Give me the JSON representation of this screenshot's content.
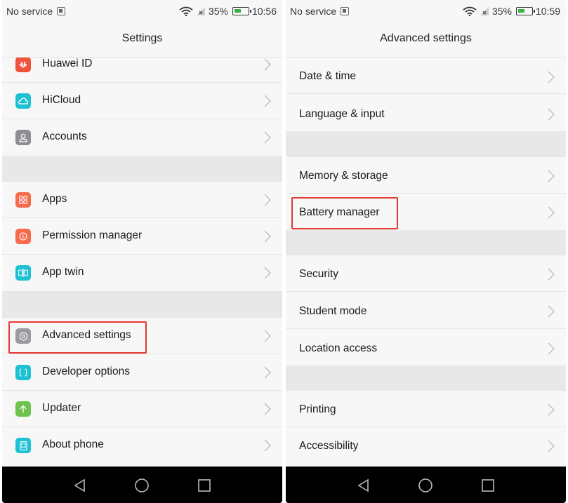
{
  "colors": {
    "highlight": "#e53935",
    "huawei_id": "#f0533b",
    "hicloud": "#1ec1d3",
    "accounts": "#8e8e93",
    "apps": "#f76b4c",
    "permission": "#f76b4c",
    "app_twin": "#1ec1d3",
    "advanced": "#9a9aa0",
    "developer": "#1ec1d3",
    "updater": "#6cc24a",
    "about": "#1ec1d3"
  },
  "left_screen": {
    "status": {
      "carrier": "No service",
      "battery": "35%",
      "time": "10:56"
    },
    "title": "Settings",
    "items": [
      {
        "label": "Huawei ID",
        "icon": "huawei-logo-icon"
      },
      {
        "label": "HiCloud",
        "icon": "cloud-icon"
      },
      {
        "label": "Accounts",
        "icon": "person-icon"
      },
      {
        "label": "Apps",
        "icon": "grid-icon"
      },
      {
        "label": "Permission manager",
        "icon": "shield-icon"
      },
      {
        "label": "App twin",
        "icon": "twin-icon"
      },
      {
        "label": "Advanced settings",
        "icon": "gear-icon"
      },
      {
        "label": "Developer options",
        "icon": "braces-icon"
      },
      {
        "label": "Updater",
        "icon": "arrow-up-icon"
      },
      {
        "label": "About phone",
        "icon": "phone-icon"
      }
    ]
  },
  "right_screen": {
    "status": {
      "carrier": "No service",
      "battery": "35%",
      "time": "10:59"
    },
    "title": "Advanced settings",
    "items": [
      {
        "label": "Date & time"
      },
      {
        "label": "Language & input"
      },
      {
        "label": "Memory & storage"
      },
      {
        "label": "Battery manager"
      },
      {
        "label": "Security"
      },
      {
        "label": "Student mode"
      },
      {
        "label": "Location access"
      },
      {
        "label": "Printing"
      },
      {
        "label": "Accessibility"
      }
    ]
  }
}
